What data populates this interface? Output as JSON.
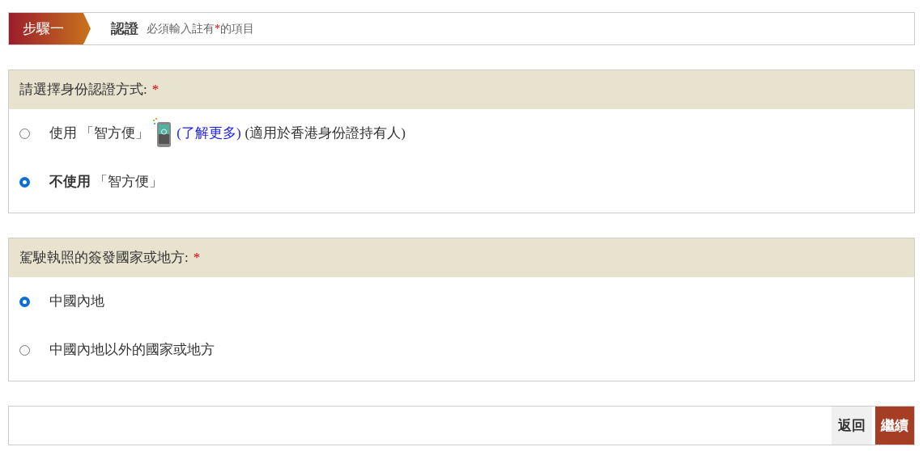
{
  "step": {
    "label": "步驟一",
    "title": "認證",
    "note": [
      "必須輸入註有",
      "*",
      "的項目"
    ]
  },
  "sections": [
    {
      "heading": "請選擇身份認證方式:",
      "required_mark": "*",
      "options": [
        {
          "kind": "app",
          "label": "使用 「智方便」",
          "link": "(了解更多)",
          "note": "(適用於香港身份證持有人)",
          "selected": false
        },
        {
          "kind": "plain",
          "label": "**不使用** 「智方便」",
          "selected": true
        }
      ]
    },
    {
      "heading": "駕駛執照的簽發國家或地方:",
      "required_mark": "*",
      "options": [
        {
          "kind": "plain",
          "label": "中國內地",
          "selected": true
        },
        {
          "kind": "plain",
          "label": "中國內地以外的國家或地方",
          "selected": false
        }
      ]
    }
  ],
  "buttons": [
    {
      "kind": "secondary",
      "label": "返回"
    },
    {
      "kind": "primary",
      "label": "繼續"
    }
  ]
}
